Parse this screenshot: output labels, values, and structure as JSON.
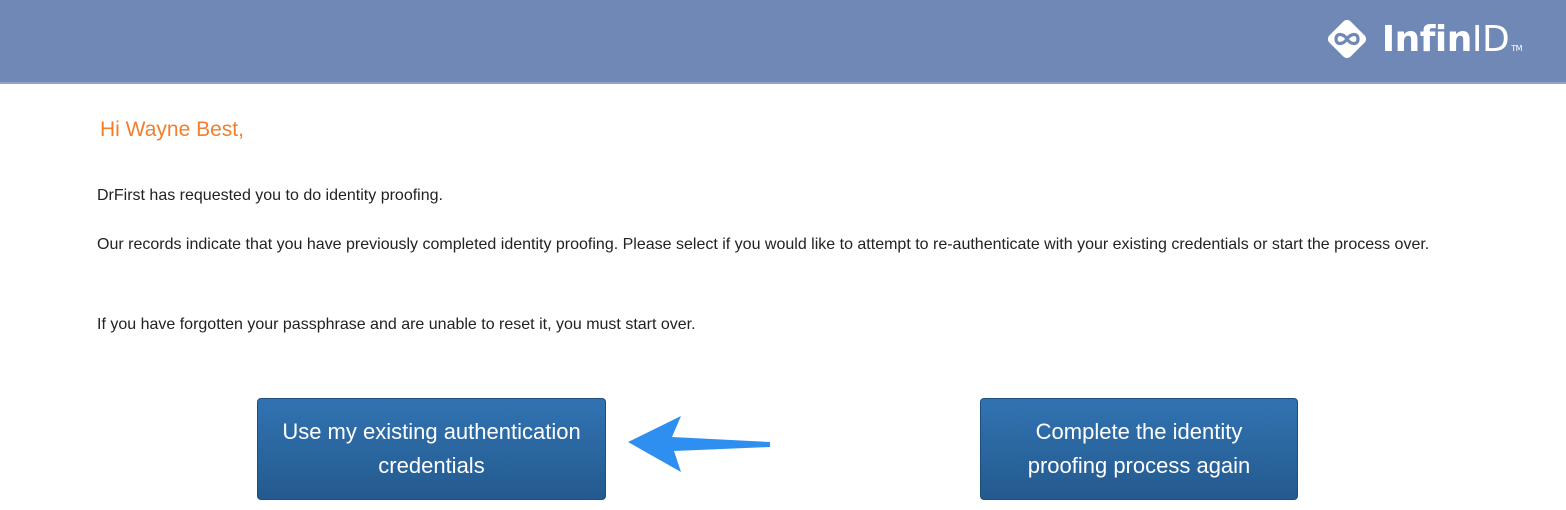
{
  "header": {
    "logo_text_bold": "Infin",
    "logo_text_light": "ID",
    "logo_mark": "TM",
    "logo_icon": "infinity-diamond-icon",
    "bg_color": "#6f88b6"
  },
  "main": {
    "greeting": "Hi Wayne Best,",
    "paragraphs": [
      "DrFirst has requested you to do identity proofing.",
      "Our records indicate that you have previously completed identity proofing. Please select if you would like to attempt to re-authenticate with your existing credentials or start the process over.",
      "If you have forgotten your passphrase and are unable to reset it, you must start over."
    ],
    "greeting_color": "#f07f2e"
  },
  "actions": {
    "existing_credentials_label": "Use my existing authentication credentials",
    "restart_proofing_label": "Complete the identity proofing process again",
    "button_color": "#2a6aa4",
    "annotation_arrow_color": "#2f8ff0"
  }
}
